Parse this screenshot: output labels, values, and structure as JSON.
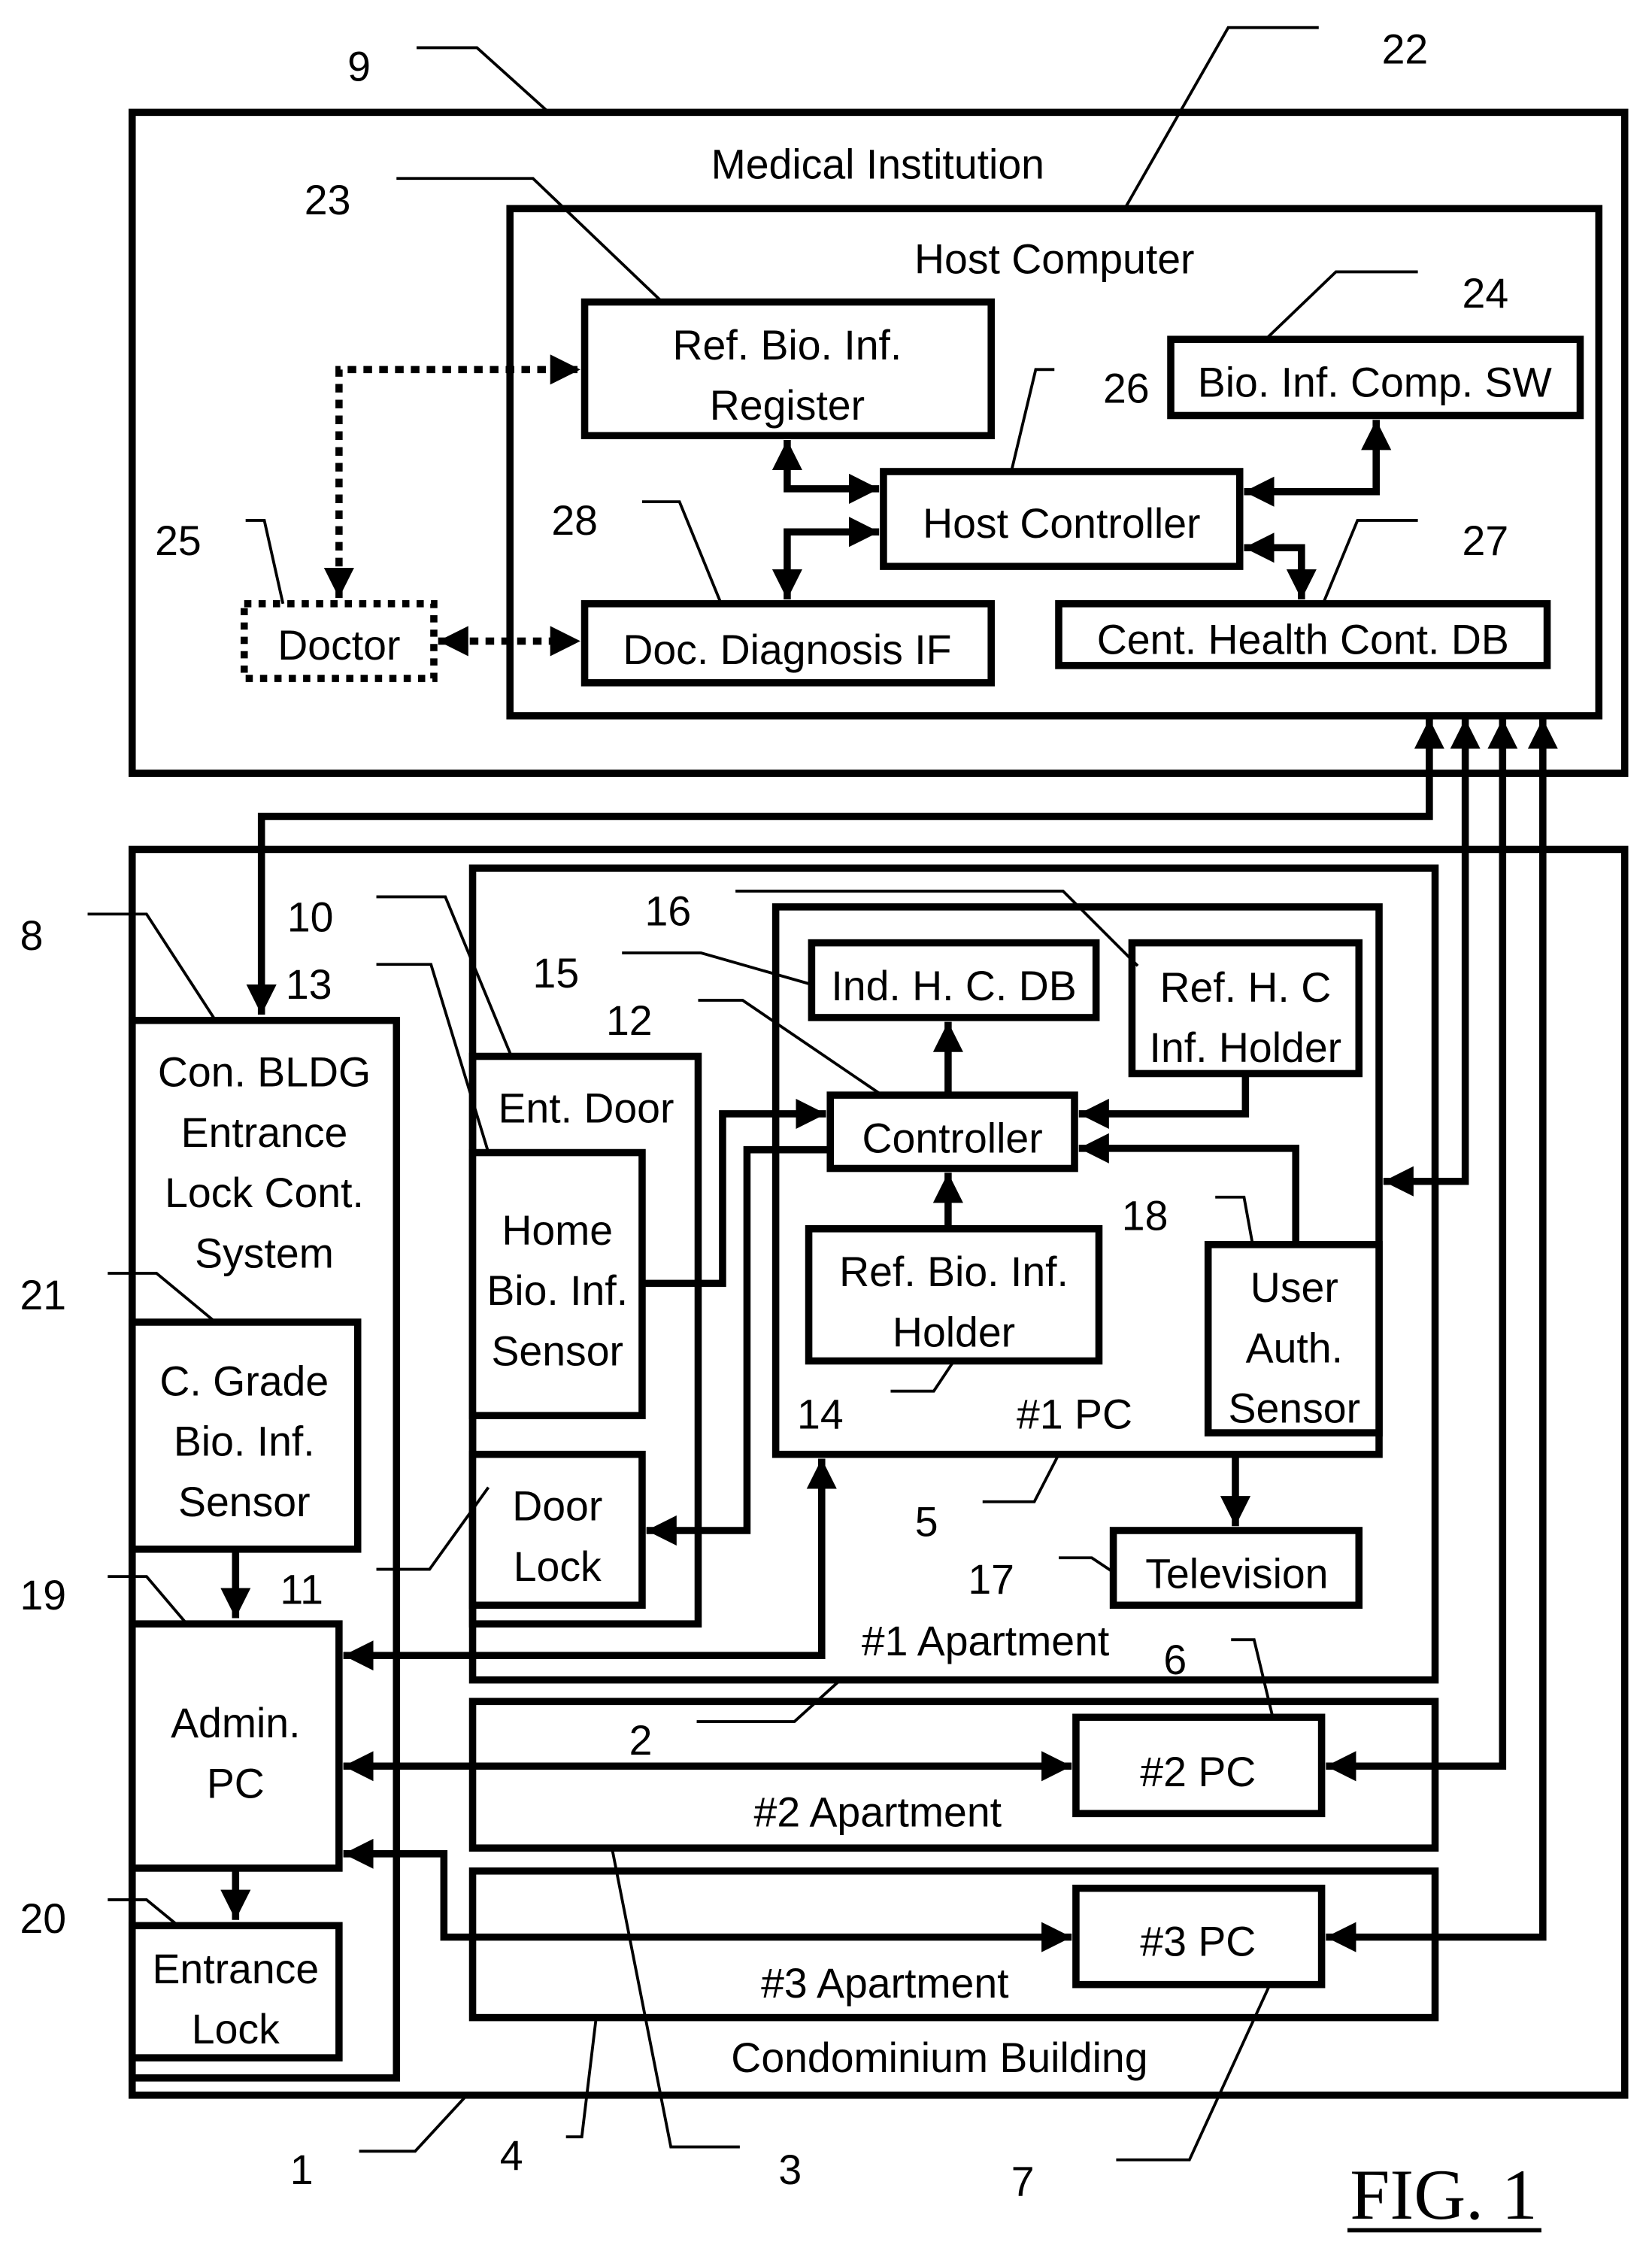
{
  "figure": {
    "title": "FIG. 1",
    "medical_institution": {
      "label": "Medical Institution",
      "ref": "9",
      "host_computer": {
        "label": "Host Computer",
        "ref": "22",
        "ref_bio_inf_register": {
          "line1": "Ref. Bio. Inf.",
          "line2": "Register",
          "ref": "23"
        },
        "bio_inf_comp_sw": {
          "label": "Bio. Inf. Comp. SW",
          "ref": "24"
        },
        "host_controller": {
          "label": "Host Controller",
          "ref": "26"
        },
        "doc_diagnosis_if": {
          "label": "Doc. Diagnosis IF",
          "ref": "28"
        },
        "cent_health_cont_db": {
          "label": "Cent. Health Cont. DB",
          "ref": "27"
        }
      },
      "doctor": {
        "label": "Doctor",
        "ref": "25"
      }
    },
    "condominium_building": {
      "label": "Condominium Building",
      "ref": "1",
      "ref_network": "4",
      "con_bldg_system": {
        "line1": "Con. BLDG",
        "line2": "Entrance",
        "line3": "Lock Cont.",
        "line4": "System",
        "ref": "8"
      },
      "c_grade_sensor": {
        "line1": "C. Grade",
        "line2": "Bio. Inf.",
        "line3": "Sensor",
        "ref": "21"
      },
      "admin_pc": {
        "line1": "Admin.",
        "line2": "PC",
        "ref": "19"
      },
      "entrance_lock": {
        "line1": "Entrance",
        "line2": "Lock",
        "ref": "20"
      },
      "apartment1": {
        "label": "#1 Apartment",
        "ref": "2",
        "ent_door": {
          "label": "Ent. Door",
          "ref": "10"
        },
        "home_sensor": {
          "line1": "Home",
          "line2": "Bio. Inf.",
          "line3": "Sensor",
          "ref": "13"
        },
        "door_lock": {
          "line1": "Door",
          "line2": "Lock",
          "ref": "11"
        },
        "pc1": {
          "label": "#1 PC",
          "ref": "5",
          "ind_hc_db": {
            "label": "Ind. H. C. DB",
            "ref": "15"
          },
          "ref_hc_holder": {
            "line1": "Ref. H. C",
            "line2": "Inf. Holder",
            "ref": "16"
          },
          "controller": {
            "label": "Controller",
            "ref": "12"
          },
          "ref_bio_holder": {
            "line1": "Ref. Bio. Inf.",
            "line2": "Holder",
            "ref": "14"
          },
          "user_auth": {
            "line1": "User",
            "line2": "Auth.",
            "line3": "Sensor",
            "ref": "18"
          }
        },
        "television": {
          "label": "Television",
          "ref": "17"
        }
      },
      "apartment2": {
        "label": "#2 Apartment",
        "ref": "3",
        "pc": {
          "label": "#2 PC",
          "ref": "6"
        }
      },
      "apartment3": {
        "label": "#3 Apartment",
        "pc": {
          "label": "#3 PC",
          "ref": "7"
        }
      }
    }
  }
}
